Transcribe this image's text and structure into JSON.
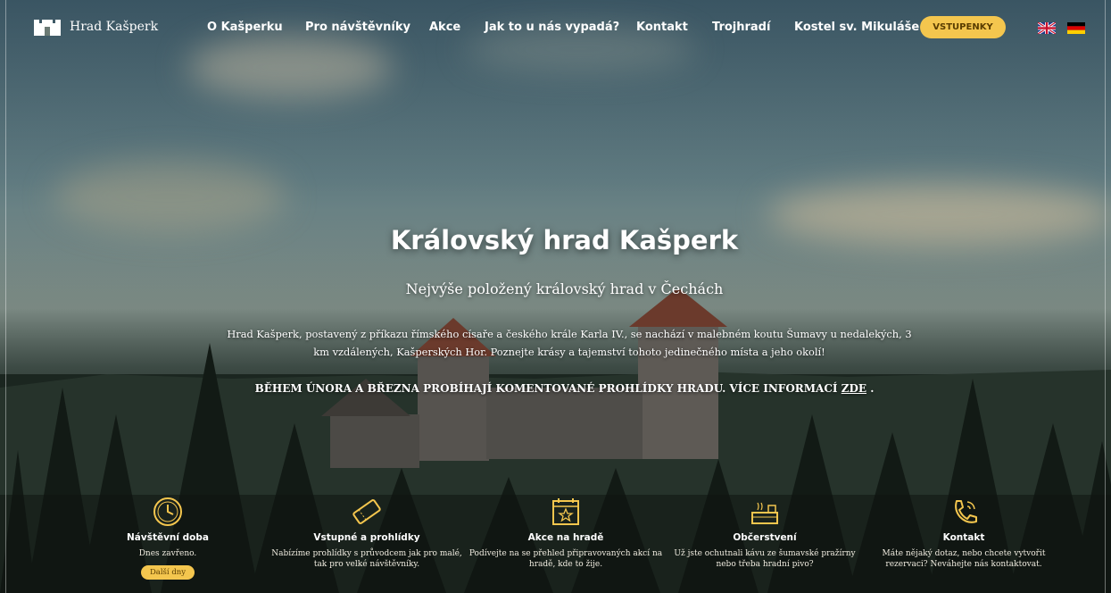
{
  "brand": {
    "name": "Hrad Kašperk"
  },
  "nav": {
    "items": [
      {
        "label": "O Kašperku"
      },
      {
        "label": "Pro návštěvníky"
      },
      {
        "label": "Akce"
      },
      {
        "label": "Jak to u nás vypadá?"
      },
      {
        "label": "Kontakt"
      },
      {
        "label": "Trojhradí"
      },
      {
        "label": "Kostel sv. Mikuláše"
      }
    ],
    "cta_label": "VSTUPENKY",
    "languages": [
      "english-flag",
      "german-flag"
    ]
  },
  "hero": {
    "title": "Královský hrad Kašperk",
    "subtitle": "Nejvýše položený královský hrad v Čechách",
    "description": "Hrad Kašperk, postavený z příkazu římského císaře a českého krále Karla IV., se nachází v malebném koutu Šumavy u nedalekých, 3 km vzdálených, Kašperských Hor. Poznejte krásy a tajemství tohoto jedinečného místa a jeho okolí!",
    "notice_text": "BĚHEM ÚNORA A BŘEZNA PROBÍHAJÍ KOMENTOVANÉ PROHLÍDKY HRADU. VÍCE INFORMACÍ",
    "notice_link": "ZDE",
    "notice_end": "."
  },
  "features": [
    {
      "icon": "clock-icon",
      "title": "Návštěvní doba",
      "text": "Dnes zavřeno.",
      "button": "Další dny"
    },
    {
      "icon": "ticket-icon",
      "title": "Vstupné a prohlídky",
      "text": "Nabízíme prohlídky s průvodcem jak pro malé, tak pro velké návštěvníky."
    },
    {
      "icon": "calendar-icon",
      "title": "Akce na hradě",
      "text": "Podívejte na se přehled připravovaných akcí na hradě, kde to žije."
    },
    {
      "icon": "cafe-icon",
      "title": "Občerstvení",
      "text": "Už jste ochutnali kávu ze šumavské pražírny nebo třeba hradní pivo?"
    },
    {
      "icon": "phone-icon",
      "title": "Kontakt",
      "text": "Máte nějaký dotaz, nebo chcete vytvořit rezervaci? Neváhejte nás kontaktovat."
    }
  ],
  "colors": {
    "accent": "#f4c64e",
    "text": "#ffffff"
  }
}
